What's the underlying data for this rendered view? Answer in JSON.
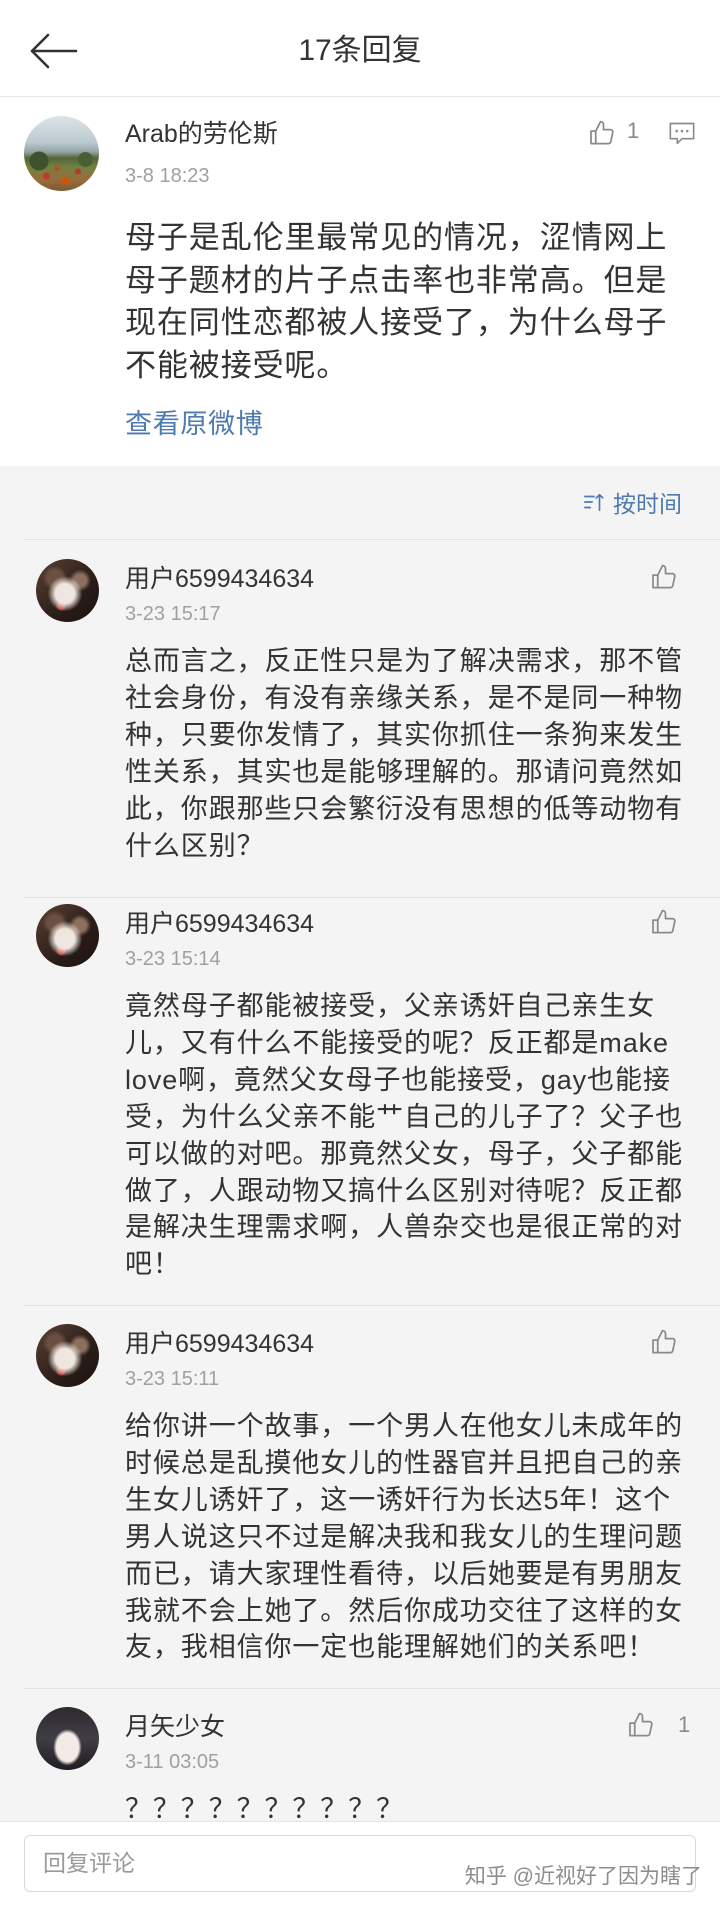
{
  "header": {
    "title": "17条回复"
  },
  "post": {
    "author": "Arab的劳伦斯",
    "time": "3-8 18:23",
    "like_count": "1",
    "body_lines": [
      "母子是乱伦里最常见的情况，涩情网上",
      "母子题材的片子点击率也非常高。但是",
      "现在同性恋都被人接受了，为什么母子",
      "不能被接受呢。"
    ],
    "link_text": "查看原微博"
  },
  "sort": {
    "label": "按时间"
  },
  "comments": [
    {
      "author": "用户6599434634",
      "time": "3-23 15:17",
      "body_lines": [
        "总而言之，反正性只是为了解决需求，那不管",
        "社会身份，有没有亲缘关系，是不是同一种物",
        "种，只要你发情了，其实你抓住一条狗来发生",
        "性关系，其实也是能够理解的。那请问竟然如",
        "此，你跟那些只会繁衍没有思想的低等动物有",
        "什么区别？"
      ]
    },
    {
      "author": "用户6599434634",
      "time": "3-23 15:14",
      "body_lines": [
        "竟然母子都能被接受，父亲诱奸自己亲生女",
        "儿，又有什么不能接受的呢？反正都是make",
        "love啊，竟然父女母子也能接受，gay也能接",
        "受，为什么父亲不能艹自己的儿子了？父子也",
        "可以做的对吧。那竟然父女，母子，父子都能",
        "做了，人跟动物又搞什么区别对待呢？反正都",
        "是解决生理需求啊，人兽杂交也是很正常的对",
        "吧！"
      ]
    },
    {
      "author": "用户6599434634",
      "time": "3-23 15:11",
      "body_lines": [
        "给你讲一个故事，一个男人在他女儿未成年的",
        "时候总是乱摸他女儿的性器官并且把自己的亲",
        "生女儿诱奸了，这一诱奸行为长达5年！这个",
        "男人说这只不过是解决我和我女儿的生理问题",
        "而已，请大家理性看待，以后她要是有男朋友",
        "我就不会上她了。然后你成功交往了这样的女",
        "友，我相信你一定也能理解她们的关系吧！"
      ]
    },
    {
      "author": "月矢少女",
      "time": "3-11 03:05",
      "like_count": "1",
      "body_lines": [
        "？？？？？？？？？？"
      ]
    }
  ],
  "reply_bar": {
    "placeholder": "回复评论"
  },
  "watermark": "知乎 @近视好了因为瞎了",
  "icons": {
    "back": "back-arrow-icon",
    "like": "thumbs-up-icon",
    "comment": "comment-icon",
    "sort": "sort-icon"
  },
  "colors": {
    "text": "#333333",
    "meta": "#a0a0a0",
    "link": "#4e7ab0",
    "icon": "#8a8a8a",
    "card_background": "#ffffff",
    "page_background": "#f4f4f4"
  }
}
